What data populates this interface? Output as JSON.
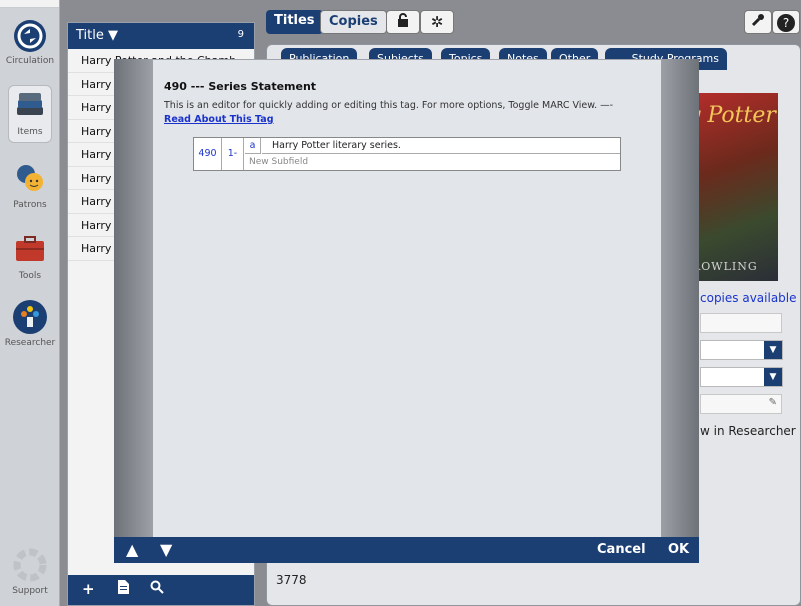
{
  "sidebar": {
    "items": [
      {
        "label": "Circulation",
        "icon": "circulation-icon"
      },
      {
        "label": "Items",
        "icon": "items-icon"
      },
      {
        "label": "Patrons",
        "icon": "patrons-icon"
      },
      {
        "label": "Tools",
        "icon": "tools-icon"
      },
      {
        "label": "Researcher",
        "icon": "researcher-icon"
      },
      {
        "label": "Support",
        "icon": "support-icon"
      }
    ]
  },
  "list": {
    "header": "Title ▼",
    "count": "9",
    "rows": [
      "Harry Potter and the Chamb",
      "Harry P",
      "Harry P",
      "Harry P",
      "Harry P",
      "Harry P",
      "Harry P",
      "Harry P",
      "Harry P"
    ],
    "footer_icons": [
      "add-icon",
      "document-icon",
      "search-icon"
    ]
  },
  "tabs": {
    "titles": "Titles",
    "copies": "Copies"
  },
  "subtabs": [
    "Publication",
    "Subjects",
    "Topics",
    "Notes",
    "Other",
    "Study Programs"
  ],
  "right": {
    "cover_title": "y Potter",
    "cover_author": "ROWLING",
    "copies_available": "copies available",
    "researcher_link": "w in Researcher"
  },
  "dialog": {
    "header": "490 --- Series Statement",
    "description": "This is an editor for quickly adding or editing this tag. For more options, Toggle MARC View. —-",
    "link": "Read About This Tag",
    "marc": {
      "tag": "490",
      "indicators": "1-",
      "code": "a",
      "value": "Harry Potter literary series.",
      "new_subfield": "New Subfield"
    },
    "cancel": "Cancel",
    "ok": "OK"
  },
  "bottom_value": "3778",
  "colors": {
    "navy": "#1c3f73",
    "link": "#1a33cc"
  }
}
